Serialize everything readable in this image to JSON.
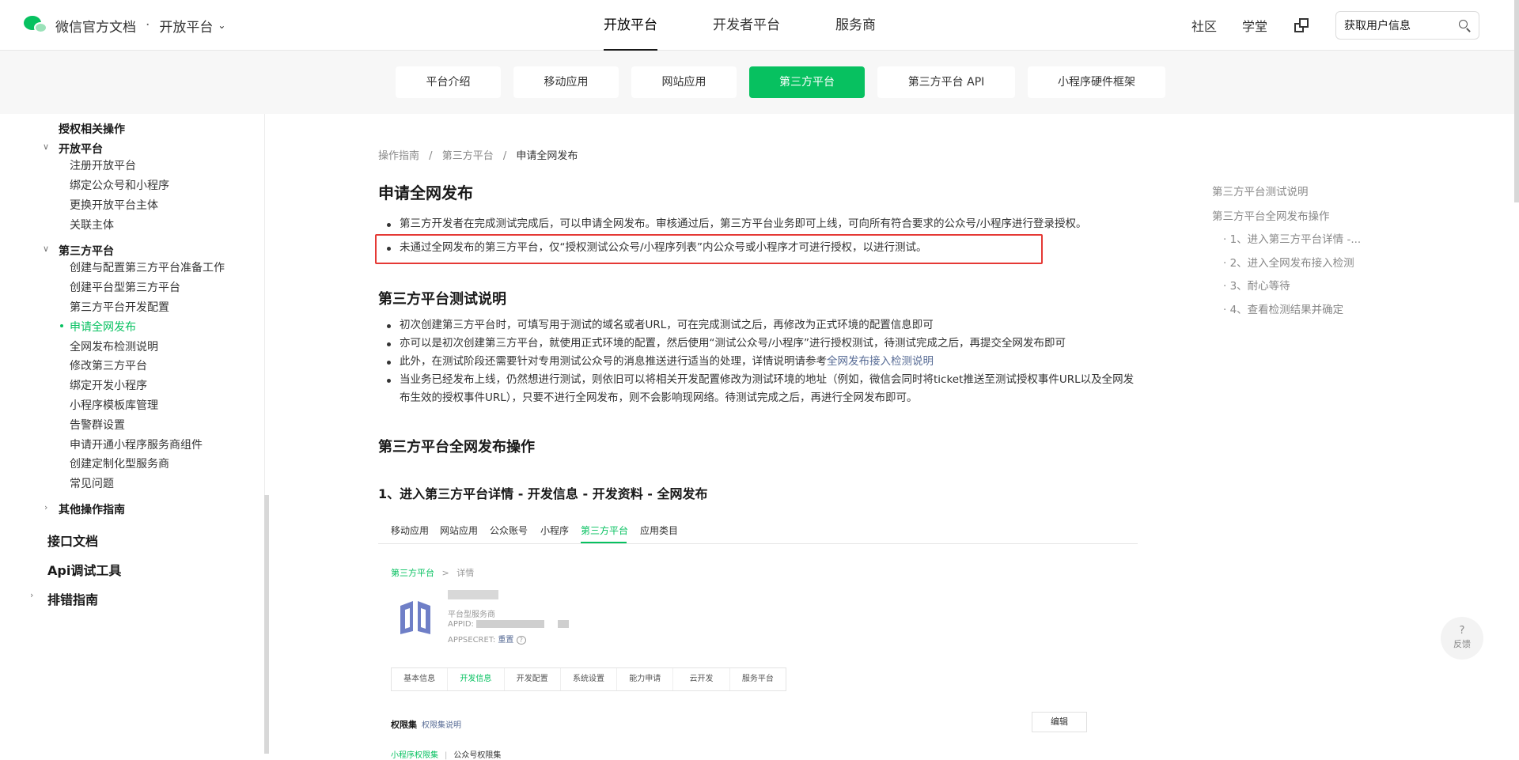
{
  "header": {
    "brand_title": "微信官方文档",
    "brand_separator": "·",
    "platform_label": "开放平台",
    "chevron": "⌄",
    "nav": [
      "开放平台",
      "开发者平台",
      "服务商"
    ],
    "right_links": [
      "社区",
      "学堂"
    ],
    "search_value": "获取用户信息"
  },
  "subtabs": [
    {
      "label": "平台介绍",
      "active": false
    },
    {
      "label": "移动应用",
      "active": false
    },
    {
      "label": "网站应用",
      "active": false
    },
    {
      "label": "第三方平台",
      "active": true
    },
    {
      "label": "第三方平台 API",
      "active": false
    },
    {
      "label": "小程序硬件框架",
      "active": false
    }
  ],
  "sidebar": {
    "auth_ops": "授权相关操作",
    "open_platform": "开放平台",
    "open_items": [
      "注册开放平台",
      "绑定公众号和小程序",
      "更换开放平台主体",
      "关联主体"
    ],
    "third_party": "第三方平台",
    "third_items": [
      "创建与配置第三方平台准备工作",
      "创建平台型第三方平台",
      "第三方平台开发配置",
      "申请全网发布",
      "全网发布检测说明",
      "修改第三方平台",
      "绑定开发小程序",
      "小程序模板库管理",
      "告警群设置",
      "申请开通小程序服务商组件",
      "创建定制化型服务商",
      "常见问题"
    ],
    "other_ops": "其他操作指南",
    "api_docs": "接口文档",
    "api_debug": "Api调试工具",
    "troubleshoot": "排错指南"
  },
  "content": {
    "breadcrumb": [
      "操作指南",
      "第三方平台",
      "申请全网发布"
    ],
    "breadcrumb_sep": "/",
    "title": "申请全网发布",
    "intro_bullets": [
      "第三方开发者在完成测试完成后，可以申请全网发布。审核通过后，第三方平台业务即可上线，可向所有符合要求的公众号/小程序进行登录授权。",
      "未通过全网发布的第三方平台，仅“授权测试公众号/小程序列表”内公众号或小程序才可进行授权，以进行测试。"
    ],
    "section1_title": "第三方平台测试说明",
    "section1_bullets": [
      "初次创建第三方平台时，可填写用于测试的域名或者URL，可在完成测试之后，再修改为正式环境的配置信息即可",
      "亦可以是初次创建第三方平台，就使用正式环境的配置，然后使用“测试公众号/小程序”进行授权测试，待测试完成之后，再提交全网发布即可"
    ],
    "section1_b3_text": "此外，在测试阶段还需要针对专用测试公众号的消息推送进行适当的处理，详情说明请参考",
    "section1_b3_link": "全网发布接入检测说明",
    "section1_b4": "当业务已经发布上线，仍然想进行测试，则依旧可以将相关开发配置修改为测试环境的地址（例如，微信会同时将ticket推送至测试授权事件URL以及全网发布生效的授权事件URL），只要不进行全网发布，则不会影响现网络。待测试完成之后，再进行全网发布即可。",
    "section2_title": "第三方平台全网发布操作",
    "step1_title": "1、进入第三方平台详情 - 开发信息 - 开发资料 - 全网发布"
  },
  "screenshot": {
    "tabs": [
      "移动应用",
      "网站应用",
      "公众账号",
      "小程序",
      "第三方平台",
      "应用类目"
    ],
    "active_tab": "第三方平台",
    "crumb_first": "第三方平台",
    "crumb_sep": ">",
    "crumb_second": "详情",
    "type_label": "平台型服务商",
    "appid_label": "APPID:",
    "appsecret_label": "APPSECRET:",
    "reset_label": "重置",
    "inner_tabs": [
      "基本信息",
      "开发信息",
      "开发配置",
      "系统设置",
      "能力申请",
      "云开发",
      "服务平台"
    ],
    "inner_active": "开发信息",
    "perm_title": "权限集",
    "perm_link": "权限集说明",
    "edit_label": "编辑",
    "bottom_green": "小程序权限集",
    "bottom_sep": "|",
    "bottom_gray": "公众号权限集"
  },
  "toc": {
    "items": [
      "第三方平台测试说明",
      "第三方平台全网发布操作"
    ],
    "sub_items": [
      "· 1、进入第三方平台详情 -...",
      "· 2、进入全网发布接入检测",
      "· 3、耐心等待",
      "· 4、查看检测结果并确定"
    ]
  },
  "feedback": {
    "icon": "?",
    "label": "反馈"
  },
  "colors": {
    "accent": "#07c160",
    "link": "#576b95",
    "highlight": "#e53935"
  }
}
